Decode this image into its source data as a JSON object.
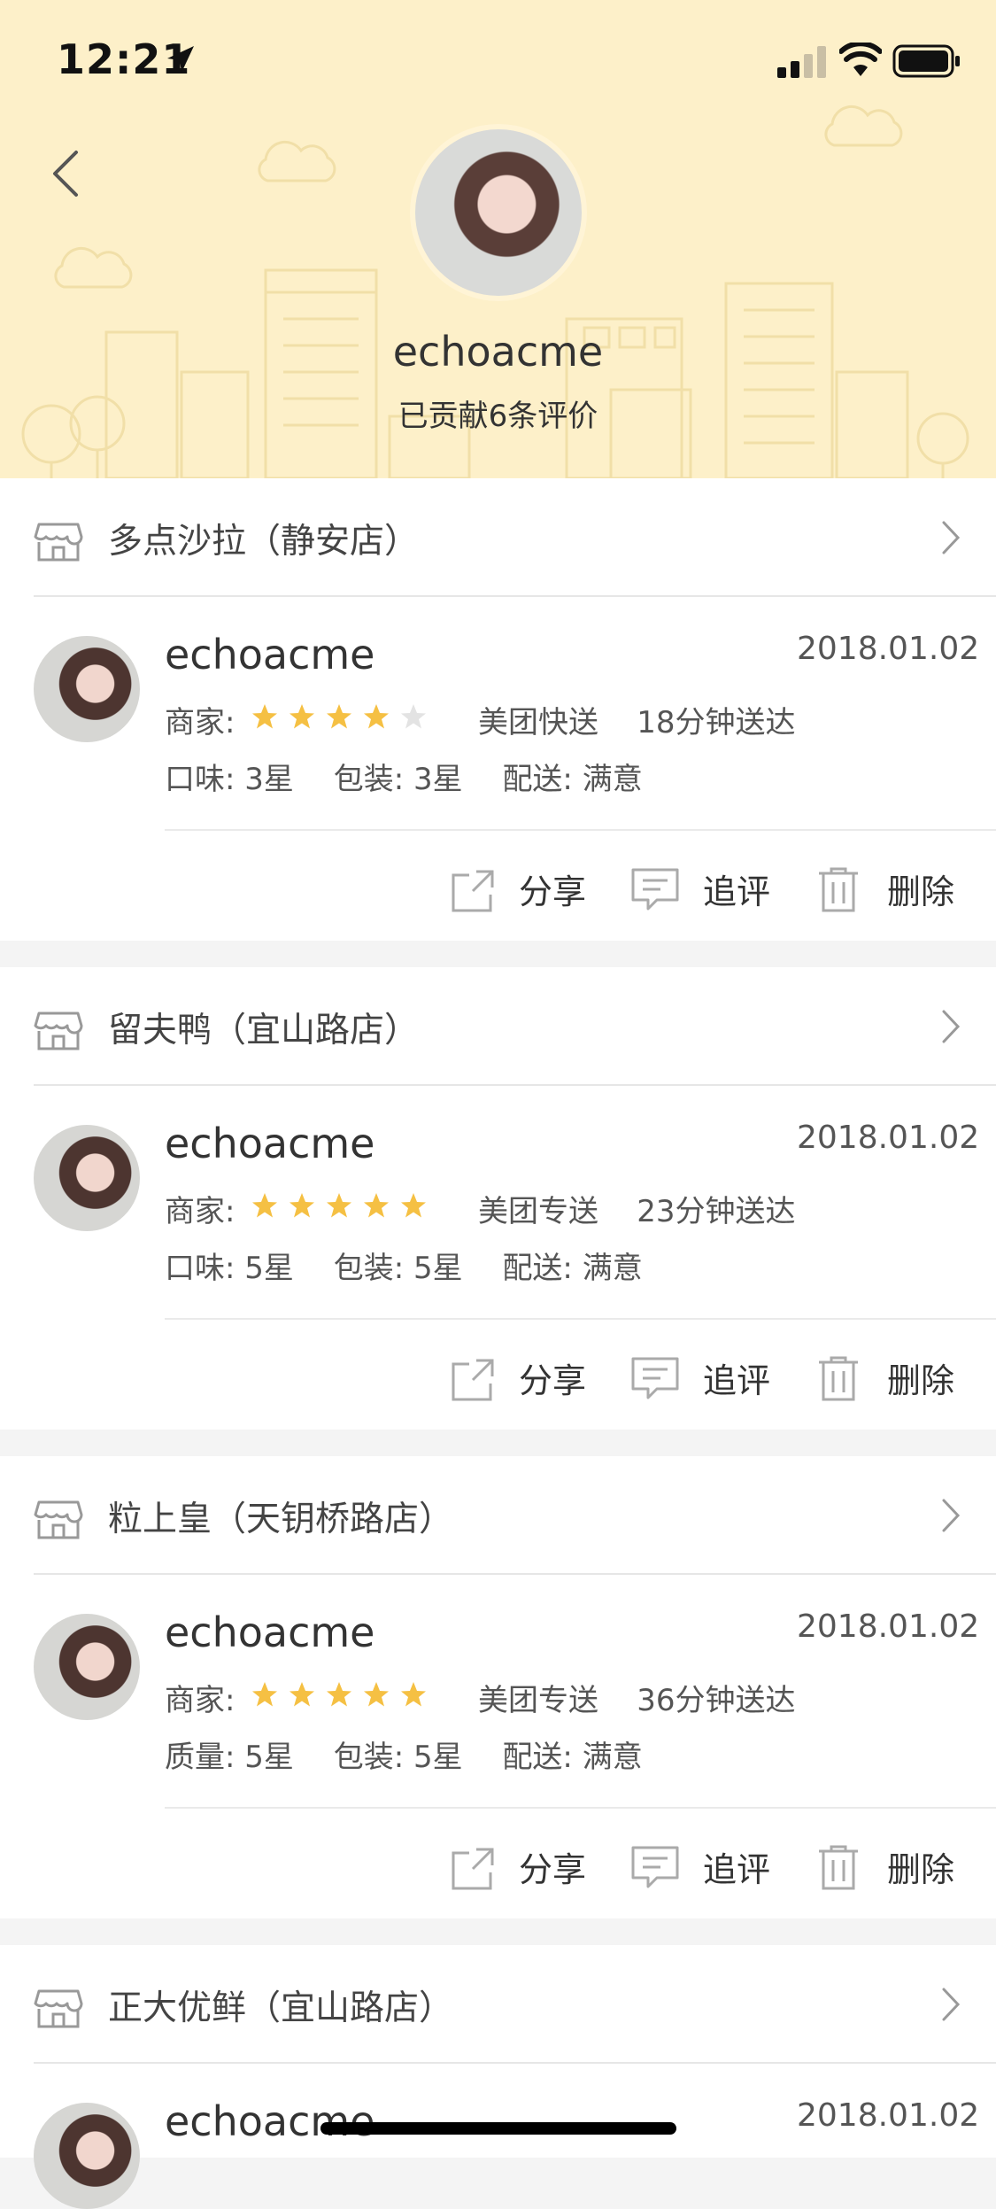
{
  "status_bar": {
    "time": "12:21"
  },
  "profile": {
    "name": "echoacme",
    "review_count_text": "已贡献6条评价"
  },
  "colors": {
    "header_bg": "#fdf0c9",
    "star_on": "#f5c043",
    "star_off": "#e3e3e3"
  },
  "actions": {
    "share": "分享",
    "follow_up": "追评",
    "delete": "删除"
  },
  "reviews": [
    {
      "shop": "多点沙拉（静安店）",
      "user": "echoacme",
      "date": "2018.01.02",
      "merchant_label": "商家:",
      "stars": 4,
      "delivery_type": "美团快送",
      "delivery_time": "18分钟送达",
      "ratings": [
        "口味: 3星",
        "包装: 3星",
        "配送: 满意"
      ]
    },
    {
      "shop": "留夫鸭（宜山路店）",
      "user": "echoacme",
      "date": "2018.01.02",
      "merchant_label": "商家:",
      "stars": 5,
      "delivery_type": "美团专送",
      "delivery_time": "23分钟送达",
      "ratings": [
        "口味: 5星",
        "包装: 5星",
        "配送: 满意"
      ]
    },
    {
      "shop": "粒上皇（天钥桥路店）",
      "user": "echoacme",
      "date": "2018.01.02",
      "merchant_label": "商家:",
      "stars": 5,
      "delivery_type": "美团专送",
      "delivery_time": "36分钟送达",
      "ratings": [
        "质量: 5星",
        "包装: 5星",
        "配送: 满意"
      ]
    },
    {
      "shop": "正大优鲜（宜山路店）",
      "user": "echoacme",
      "date": "2018.01.02"
    }
  ]
}
